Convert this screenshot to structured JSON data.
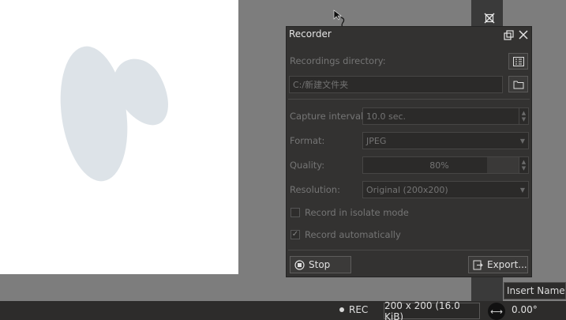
{
  "docker": {
    "title": "Recorder",
    "recordings_directory_label": "Recordings directory:",
    "directory_value": "C:/新建文件夹",
    "capture_interval_label": "Capture interval:",
    "capture_interval_value": "10.0 sec.",
    "format_label": "Format:",
    "format_value": "JPEG",
    "quality_label": "Quality:",
    "quality_value": "80%",
    "resolution_label": "Resolution:",
    "resolution_value": "Original (200x200)",
    "isolate_label": "Record in isolate mode",
    "isolate_checked": false,
    "auto_label": "Record automatically",
    "auto_checked": true,
    "stop_label": "Stop",
    "export_label": "Export..."
  },
  "statusbar": {
    "rec_label": "REC",
    "dimensions": "200 x 200 (16.0 KiB)",
    "rotation": "0.00°"
  },
  "insert_name": "Insert Name",
  "icons": {
    "float": "float-window-icon",
    "detach": "detach-icon",
    "close": "close-icon",
    "list": "list-icon",
    "folder": "folder-icon",
    "stop": "stop-icon",
    "export": "export-icon",
    "rotate": "rotate-icon"
  }
}
